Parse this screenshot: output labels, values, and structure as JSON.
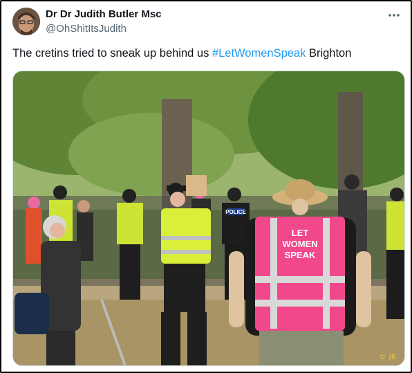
{
  "author": {
    "display_name": "Dr Dr Judith Butler Msc",
    "handle": "@OhShitItsJudith"
  },
  "tweet": {
    "text_before": "The cretins tried to sneak up behind us ",
    "hashtag": "#LetWomenSpeak",
    "text_after": " Brighton"
  },
  "photo": {
    "vest_lines": [
      "LET",
      "WOMEN",
      "SPEAK"
    ],
    "badge": "POLICE",
    "watermark": "© JK"
  },
  "icons": {
    "more": "more-horizontal-icon"
  },
  "colors": {
    "hashtag": "#1d9bf0",
    "name": "#0f1419",
    "handle": "#536471",
    "hi_vis_yellow": "#d9ef3a",
    "pink_vest": "#f0488a"
  }
}
